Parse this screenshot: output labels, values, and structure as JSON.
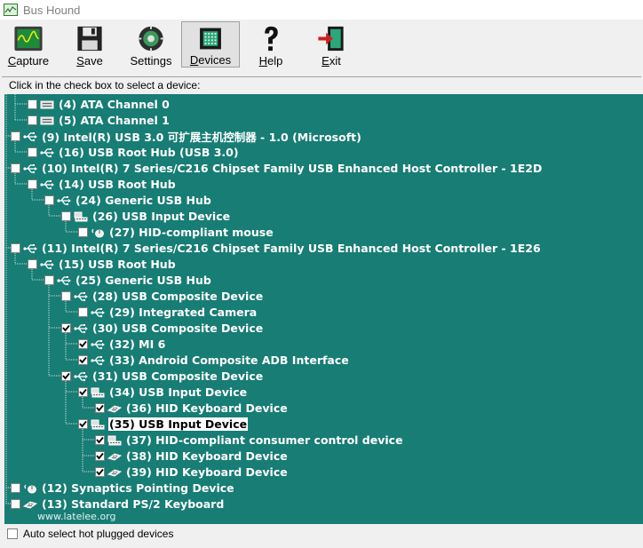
{
  "window": {
    "title": "Bus Hound"
  },
  "toolbar": {
    "buttons": [
      {
        "key": "capture",
        "label": "Capture",
        "accel": "C",
        "rest": "apture"
      },
      {
        "key": "save",
        "label": "Save",
        "accel": "S",
        "rest": "ave"
      },
      {
        "key": "settings",
        "label": "Settings",
        "accel": "",
        "rest": "Settings"
      },
      {
        "key": "devices",
        "label": "Devices",
        "accel": "D",
        "rest": "evices"
      },
      {
        "key": "help",
        "label": "Help",
        "accel": "H",
        "rest": "elp"
      },
      {
        "key": "exit",
        "label": "Exit",
        "accel": "E",
        "rest": "xit"
      }
    ]
  },
  "panel": {
    "hint": "Click in the check box to select a device:",
    "watermark": "www.latelee.org",
    "auto_select_label": "Auto select hot plugged devices",
    "auto_select_checked": false
  },
  "devices": [
    {
      "label": "(4) ATA Channel 0",
      "depth": 1,
      "icon": "disk-icon",
      "checked": false
    },
    {
      "label": "(5) ATA Channel 1",
      "depth": 1,
      "icon": "disk-icon",
      "checked": false
    },
    {
      "label": "(9) Intel(R) USB 3.0 可扩展主机控制器 - 1.0 (Microsoft)",
      "depth": 0,
      "icon": "usb-icon",
      "checked": false
    },
    {
      "label": "(16) USB Root Hub (USB 3.0)",
      "depth": 1,
      "icon": "usb-icon",
      "checked": false
    },
    {
      "label": "(10) Intel(R) 7 Series/C216 Chipset Family USB Enhanced Host Controller - 1E2D",
      "depth": 0,
      "icon": "usb-icon",
      "checked": false
    },
    {
      "label": "(14) USB Root Hub",
      "depth": 1,
      "icon": "usb-icon",
      "checked": false
    },
    {
      "label": "(24) Generic USB Hub",
      "depth": 2,
      "icon": "usb-icon",
      "checked": false
    },
    {
      "label": "(26) USB Input Device",
      "depth": 3,
      "icon": "input-device-icon",
      "checked": false
    },
    {
      "label": "(27) HID-compliant mouse",
      "depth": 4,
      "icon": "mouse-icon",
      "checked": false
    },
    {
      "label": "(11) Intel(R) 7 Series/C216 Chipset Family USB Enhanced Host Controller - 1E26",
      "depth": 0,
      "icon": "usb-icon",
      "checked": false
    },
    {
      "label": "(15) USB Root Hub",
      "depth": 1,
      "icon": "usb-icon",
      "checked": false
    },
    {
      "label": "(25) Generic USB Hub",
      "depth": 2,
      "icon": "usb-icon",
      "checked": false
    },
    {
      "label": "(28) USB Composite Device",
      "depth": 3,
      "icon": "usb-icon",
      "checked": false
    },
    {
      "label": "(29) Integrated Camera",
      "depth": 4,
      "icon": "usb-icon",
      "checked": false
    },
    {
      "label": "(30) USB Composite Device",
      "depth": 3,
      "icon": "usb-icon",
      "checked": true
    },
    {
      "label": "(32) MI 6",
      "depth": 4,
      "icon": "usb-icon",
      "checked": true
    },
    {
      "label": "(33) Android Composite ADB Interface",
      "depth": 4,
      "icon": "usb-icon",
      "checked": true
    },
    {
      "label": "(31) USB Composite Device",
      "depth": 3,
      "icon": "usb-icon",
      "checked": true
    },
    {
      "label": "(34) USB Input Device",
      "depth": 4,
      "icon": "input-device-icon",
      "checked": true
    },
    {
      "label": "(36) HID Keyboard Device",
      "depth": 5,
      "icon": "keyboard-icon",
      "checked": true
    },
    {
      "label": "(35) USB Input Device",
      "depth": 4,
      "icon": "input-device-icon",
      "checked": true,
      "selected": true
    },
    {
      "label": "(37) HID-compliant consumer control device",
      "depth": 5,
      "icon": "input-device-icon",
      "checked": true
    },
    {
      "label": "(38) HID Keyboard Device",
      "depth": 5,
      "icon": "keyboard-icon",
      "checked": true
    },
    {
      "label": "(39) HID Keyboard Device",
      "depth": 5,
      "icon": "keyboard-icon",
      "checked": true
    },
    {
      "label": "(12) Synaptics Pointing Device",
      "depth": 0,
      "icon": "mouse-icon",
      "checked": false
    },
    {
      "label": "(13) Standard PS/2 Keyboard",
      "depth": 0,
      "icon": "keyboard-icon",
      "checked": false
    }
  ]
}
